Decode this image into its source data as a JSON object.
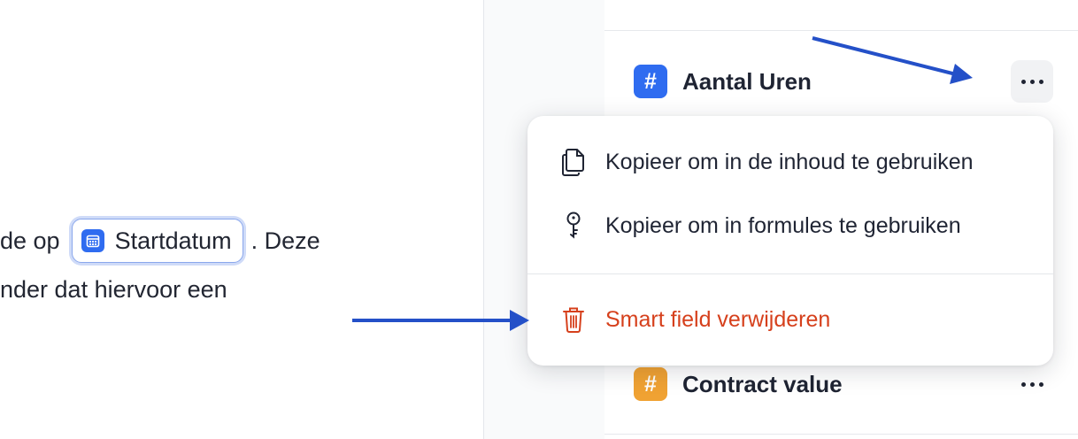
{
  "document": {
    "line1_before": "de op",
    "chip_label": "Startdatum",
    "line1_after": ". Deze",
    "line2": "nder dat hiervoor een"
  },
  "fields": [
    {
      "symbol": "#",
      "name": "Aantal Uren",
      "color": "#2f6cf0"
    },
    {
      "symbol": "#",
      "name": "Contract value",
      "color": "#f0a233"
    }
  ],
  "menu": {
    "copy_content": "Kopieer om in de inhoud te gebruiken",
    "copy_formulas": "Kopieer om in formules te gebruiken",
    "delete": "Smart field verwijderen"
  },
  "colors": {
    "accent": "#2f6cf0",
    "danger": "#d6401c",
    "annotation_arrow": "#2450c8"
  }
}
